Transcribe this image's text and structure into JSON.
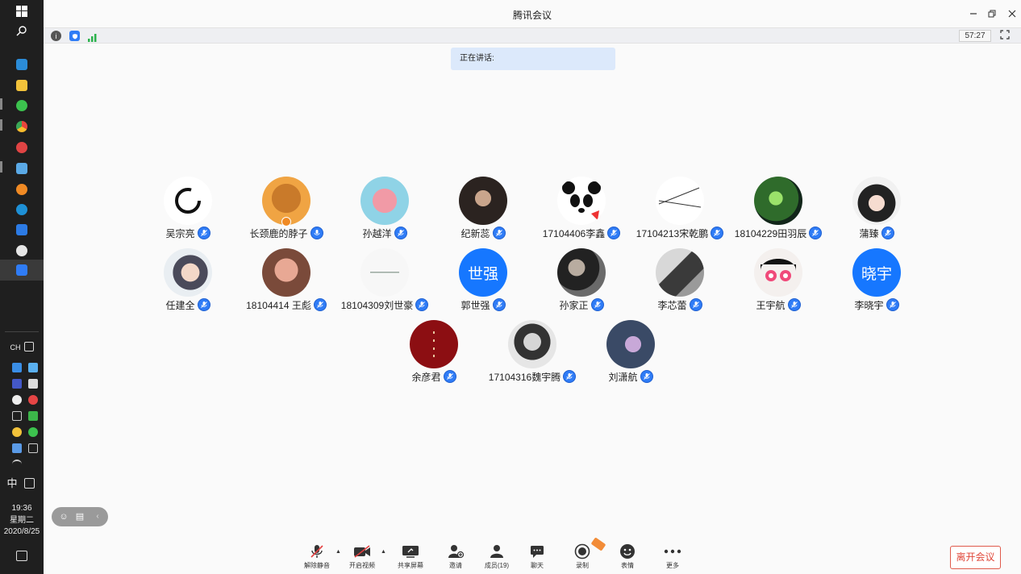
{
  "window": {
    "title": "腾讯会议"
  },
  "status": {
    "timer": "57:27"
  },
  "speaking": {
    "label": "正在讲话:"
  },
  "participants": [
    {
      "name": "吴宗亮"
    },
    {
      "name": "长颈鹿的脖子"
    },
    {
      "name": "孙越洋"
    },
    {
      "name": "纪新蕊"
    },
    {
      "name": "17104406李鑫"
    },
    {
      "name": "17104213宋乾鹏"
    },
    {
      "name": "18104229田羽辰"
    },
    {
      "name": "蒲臻"
    },
    {
      "name": "任建全"
    },
    {
      "name": "18104414 王彪"
    },
    {
      "name": "18104309刘世豪"
    },
    {
      "name": "郭世强",
      "avatar_text": "世强",
      "avatar_color": "#1677ff"
    },
    {
      "name": "孙家正"
    },
    {
      "name": "李芯蕾"
    },
    {
      "name": "王宇航"
    },
    {
      "name": "李晓宇",
      "avatar_text": "晓宇",
      "avatar_color": "#1677ff"
    },
    {
      "name": "余彦君"
    },
    {
      "name": "17104316魏宇腾"
    },
    {
      "name": "刘潇航"
    }
  ],
  "toolbar": {
    "unmute": "解除静音",
    "video": "开启视频",
    "share": "共享屏幕",
    "invite": "邀请",
    "members": "成员(19)",
    "chat": "聊天",
    "record": "录制",
    "emoji": "表情",
    "more": "更多",
    "leave": "离开会议"
  },
  "taskbar": {
    "lang": "CH",
    "ime": "中",
    "time": "19:36",
    "weekday": "星期二",
    "date": "2020/8/25"
  },
  "colors": {
    "accent": "#2f7cf6",
    "leave": "#e0473a",
    "banner": "#dce9fb"
  }
}
